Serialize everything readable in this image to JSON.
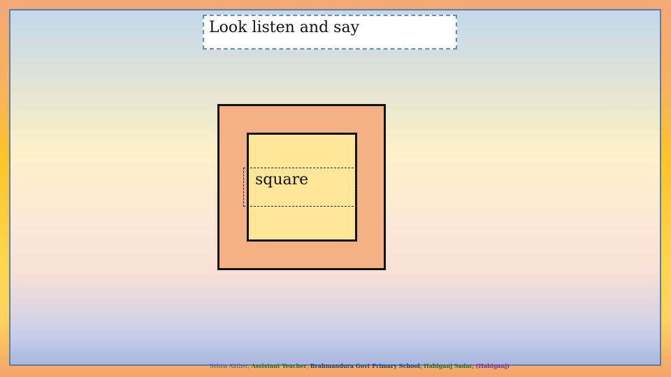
{
  "title": "Look listen and say",
  "word": "square",
  "footer": {
    "name": "Selma Akther",
    "sep1": ",",
    "role": "Assistant Teacher",
    "sep2": ",",
    "school": "Brahmandura Govt Primary School,",
    "area": "Habiganj Sadar,",
    "district": "(Habiganj)"
  },
  "colors": {
    "outer_square": "#f4b183",
    "inner_square": "#ffe699",
    "frame_border": "#5b7fa6",
    "title_border": "#5b8fc9"
  }
}
